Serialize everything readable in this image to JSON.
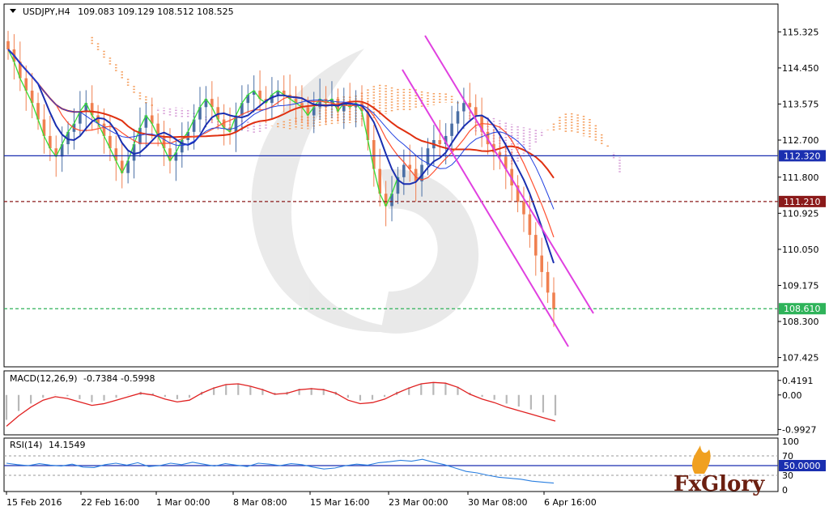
{
  "chart_data": [
    {
      "type": "candlestick",
      "symbol": "USDJPY,H4",
      "ohlc_header": "109.083 109.129 108.512 108.525",
      "ylim": [
        107.2,
        116.0
      ],
      "y_ticks": [
        "115.325",
        "114.450",
        "113.575",
        "112.700",
        "111.800",
        "110.925",
        "110.050",
        "109.175",
        "108.300",
        "107.425"
      ],
      "x_ticks": [
        "15 Feb 2016",
        "22 Feb 16:00",
        "1 Mar 00:00",
        "8 Mar 08:00",
        "15 Mar 16:00",
        "23 Mar 00:00",
        "30 Mar 08:00",
        "6 Apr 16:00"
      ],
      "horizontal_levels": [
        {
          "label": "112.320",
          "value": 112.32,
          "color": "#1a2fb0",
          "style": "solid"
        },
        {
          "label": "111.210",
          "value": 111.21,
          "color": "#8b1a1a",
          "style": "dashed"
        },
        {
          "label": "108.610",
          "value": 108.61,
          "color": "#2fb35a",
          "style": "dashed"
        }
      ],
      "close_series": [
        114.9,
        114.6,
        114.2,
        113.9,
        113.6,
        113.2,
        112.8,
        112.5,
        112.3,
        112.6,
        112.9,
        113.1,
        113.4,
        113.6,
        113.3,
        113.1,
        112.8,
        112.5,
        112.2,
        111.9,
        112.2,
        112.6,
        113.0,
        113.3,
        113.1,
        112.8,
        112.5,
        112.2,
        112.4,
        112.7,
        112.9,
        113.2,
        113.5,
        113.7,
        113.5,
        113.2,
        113.0,
        112.9,
        113.3,
        113.6,
        113.8,
        113.9,
        113.7,
        113.6,
        113.8,
        113.9,
        113.8,
        113.7,
        113.6,
        113.5,
        113.3,
        113.5,
        113.7,
        113.6,
        113.7,
        113.4,
        113.6,
        113.5,
        113.6,
        113.4,
        112.7,
        112.0,
        111.4,
        111.1,
        111.4,
        111.8,
        112.1,
        112.0,
        111.7,
        112.1,
        112.5,
        112.7,
        112.6,
        112.8,
        113.1,
        113.4,
        113.6,
        113.5,
        113.3,
        112.9,
        112.6,
        112.4,
        112.3,
        112.0,
        111.6,
        111.2,
        110.9,
        110.4,
        109.9,
        109.5,
        109.0,
        108.6
      ]
    },
    {
      "type": "line",
      "name": "MACD(12,26,9)",
      "header": "-0.7384 -0.5998",
      "y_ticks": [
        "0.4191",
        "0.00",
        "-0.9927"
      ],
      "ylim": [
        -1.1,
        0.6
      ],
      "values": [
        -0.9,
        -0.6,
        -0.35,
        -0.15,
        -0.05,
        -0.1,
        -0.2,
        -0.3,
        -0.25,
        -0.15,
        -0.05,
        0.05,
        0.0,
        -0.12,
        -0.2,
        -0.15,
        0.05,
        0.2,
        0.3,
        0.32,
        0.25,
        0.15,
        0.02,
        0.05,
        0.15,
        0.18,
        0.15,
        0.05,
        -0.15,
        -0.25,
        -0.22,
        -0.12,
        0.05,
        0.2,
        0.32,
        0.36,
        0.34,
        0.22,
        0.02,
        -0.12,
        -0.22,
        -0.35,
        -0.45,
        -0.55,
        -0.65,
        -0.75
      ]
    },
    {
      "type": "line",
      "name": "RSI(14)",
      "header": "14.1549",
      "y_ticks": [
        "100",
        "70",
        "50.0000",
        "30",
        "0"
      ],
      "ylim": [
        0,
        100
      ],
      "values": [
        55,
        52,
        50,
        54,
        51,
        49,
        53,
        47,
        46,
        52,
        55,
        51,
        56,
        48,
        50,
        55,
        52,
        57,
        53,
        49,
        54,
        51,
        48,
        55,
        53,
        50,
        54,
        52,
        47,
        43,
        45,
        50,
        53,
        51,
        56,
        58,
        61,
        59,
        63,
        57,
        52,
        45,
        38,
        35,
        30,
        26,
        24,
        22,
        18,
        16,
        14
      ]
    }
  ],
  "brand": {
    "text": "FxGlory"
  }
}
